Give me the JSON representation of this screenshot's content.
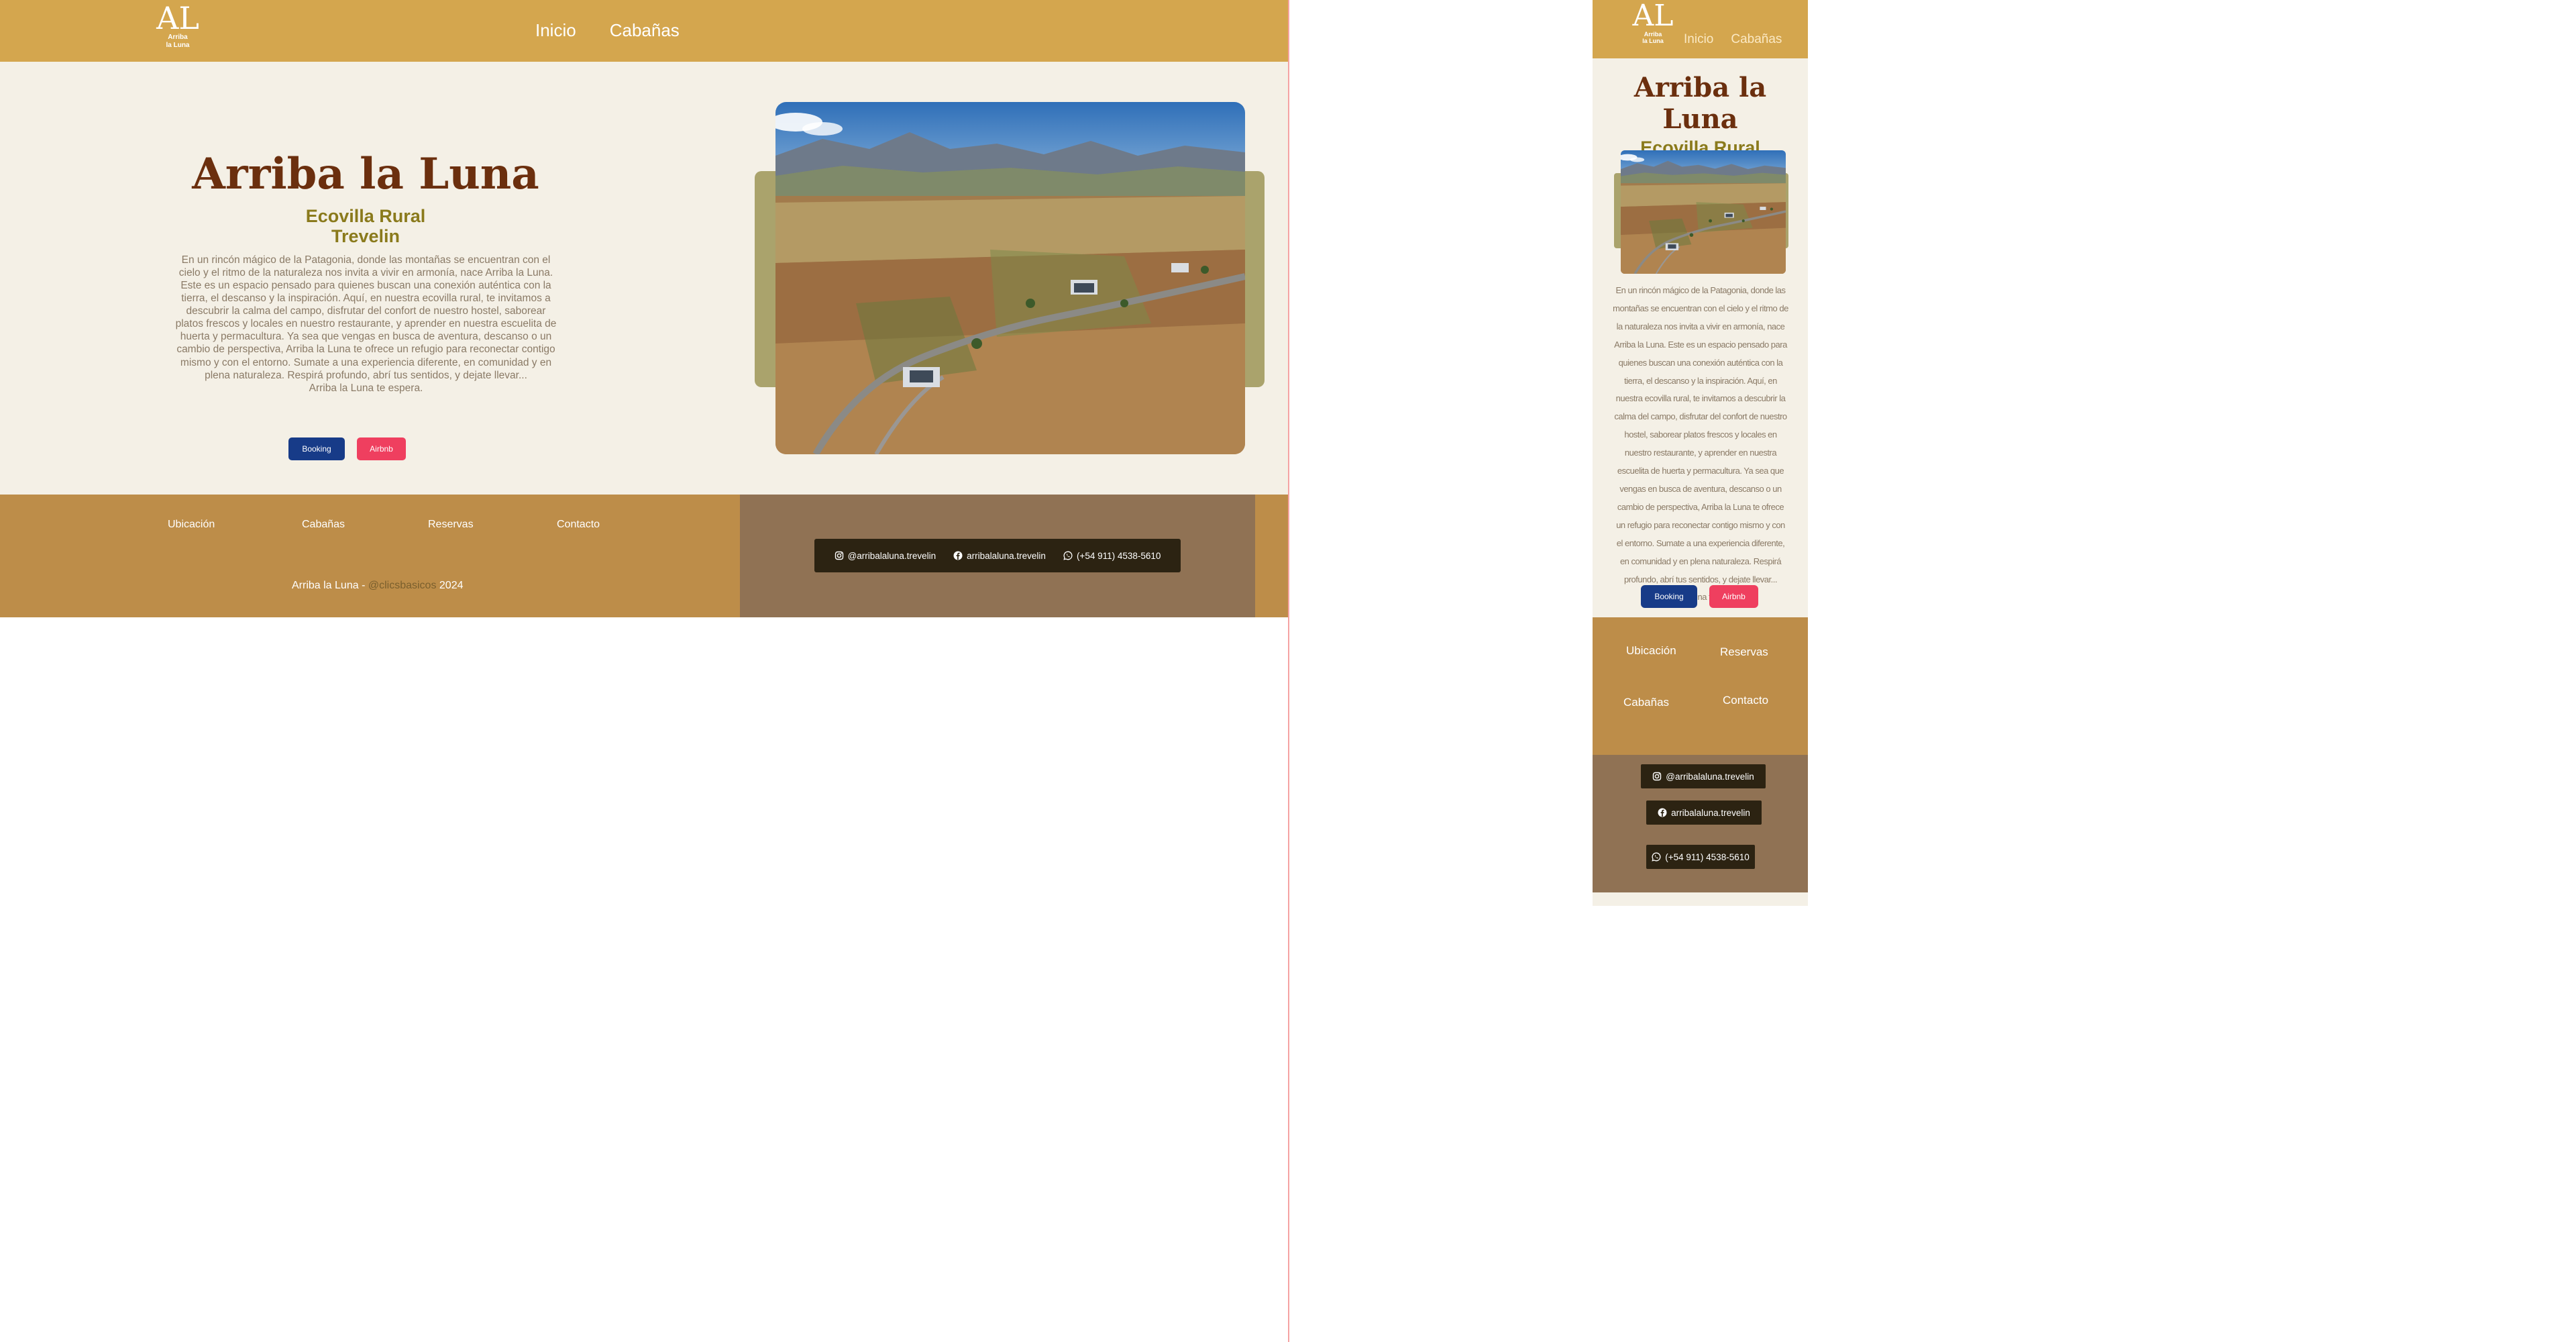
{
  "brand": {
    "logo_mark": "AL",
    "logo_line1": "Arriba",
    "logo_line2": "la Luna"
  },
  "nav": {
    "items": [
      "Inicio",
      "Cabañas"
    ]
  },
  "hero": {
    "title": "Arriba la Luna",
    "subtitle_line1": "Ecovilla Rural",
    "subtitle_line2": "Trevelin",
    "body": "En un rincón mágico de la Patagonia, donde las montañas se encuentran con el cielo y el ritmo de la naturaleza nos invita a vivir en armonía, nace Arriba la Luna. Este es un espacio pensado para quienes buscan una conexión auténtica con la tierra, el descanso y la inspiración. Aquí, en nuestra ecovilla rural, te invitamos a descubrir la calma del campo, disfrutar del confort de nuestro hostel, saborear platos frescos y locales en nuestro restaurante, y aprender en nuestra escuelita de huerta y permacultura. Ya sea que vengas en busca de aventura, descanso o un cambio de perspectiva, Arriba la Luna te ofrece un refugio para reconectar contigo mismo y con el entorno. Sumate a una experiencia diferente, en comunidad y en plena naturaleza. Respirá profundo, abrí tus sentidos, y dejate llevar...",
    "closing": "Arriba la Luna te espera.",
    "booking_label": "Booking",
    "airbnb_label": "Airbnb"
  },
  "footer": {
    "links": [
      "Ubicación",
      "Cabañas",
      "Reservas",
      "Contacto"
    ],
    "copyright_name": "Arriba la Luna",
    "copyright_sep": " - ",
    "copyright_credit": "@clicsbasicos",
    "copyright_year": " 2024",
    "social": {
      "instagram": "@arribalaluna.trevelin",
      "facebook": "arribalaluna.trevelin",
      "whatsapp": "(+54 911) 4538-5610"
    }
  },
  "colors": {
    "header": "#d4a64e",
    "hero_bg": "#f4f0e6",
    "title": "#6b2f0e",
    "subtitle": "#8a7a1c",
    "footer_left": "#bd8d49",
    "footer_right": "#907254",
    "booking": "#173b88",
    "airbnb": "#ef3f5f"
  },
  "icons": {
    "instagram": "instagram-icon",
    "facebook": "facebook-icon",
    "whatsapp": "whatsapp-icon",
    "photo": "aerial-landscape-photo"
  }
}
